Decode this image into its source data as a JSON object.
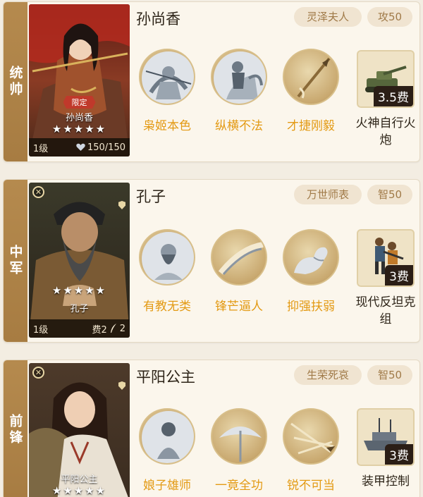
{
  "cards": [
    {
      "position": "统帅",
      "name": "孙尚香",
      "tags": [
        "灵泽夫人",
        "攻50"
      ],
      "portrait": {
        "badge": "限定",
        "name": "孙尚香",
        "stars": "★★★★★",
        "level": "1级",
        "hp": "150/150",
        "cost": "",
        "slots": ""
      },
      "skills": [
        "枭姬本色",
        "纵横不法",
        "才捷刚毅"
      ],
      "equipment": {
        "cost": "3.5费",
        "label": "火神自行火炮"
      }
    },
    {
      "position": "中军",
      "name": "孔子",
      "tags": [
        "万世师表",
        "智50"
      ],
      "portrait": {
        "badge": "",
        "name": "孔子",
        "stars": "★★★★★",
        "level": "1级",
        "hp": "",
        "cost": "费2",
        "slots": "2"
      },
      "skills": [
        "有教无类",
        "锋芒逼人",
        "抑强扶弱"
      ],
      "equipment": {
        "cost": "3费",
        "label": "现代反坦克组"
      }
    },
    {
      "position": "前锋",
      "name": "平阳公主",
      "tags": [
        "生荣死哀",
        "智50"
      ],
      "portrait": {
        "badge": "",
        "name": "平阳公主",
        "stars": "★★★★★",
        "level": "",
        "hp": "",
        "cost": "",
        "slots": ""
      },
      "skills": [
        "娘子雄师",
        "一竟全功",
        "锐不可当"
      ],
      "equipment": {
        "cost": "3费",
        "label": "装甲控制"
      }
    }
  ]
}
